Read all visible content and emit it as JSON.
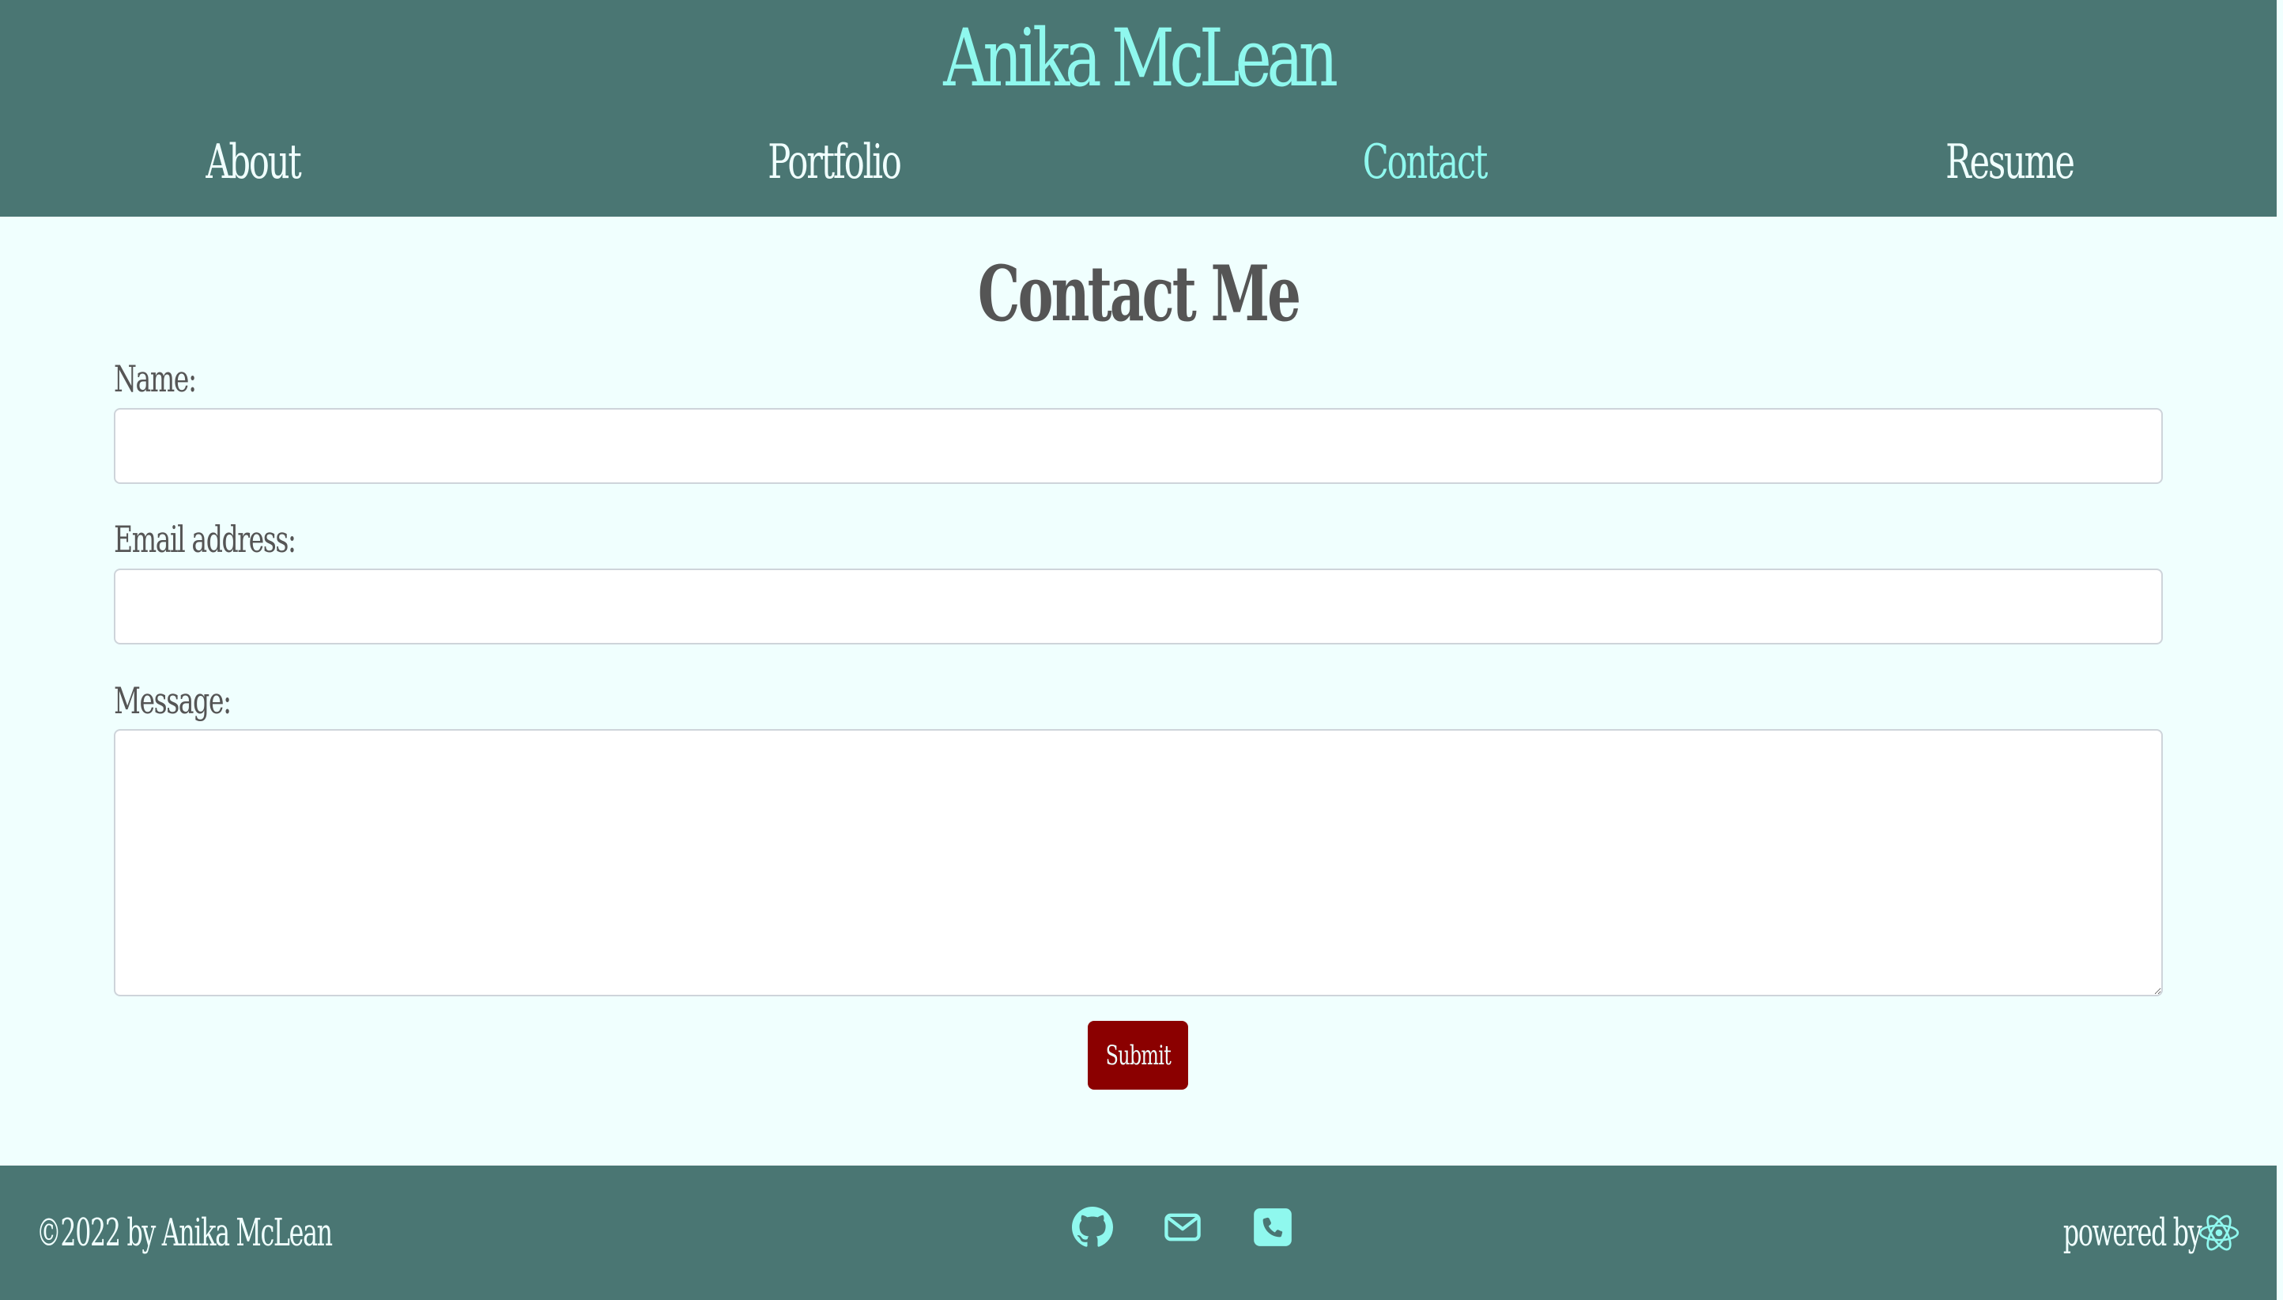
{
  "header": {
    "site_title": "Anika McLean",
    "nav": [
      {
        "label": "About",
        "active": false
      },
      {
        "label": "Portfolio",
        "active": false
      },
      {
        "label": "Contact",
        "active": true
      },
      {
        "label": "Resume",
        "active": false
      }
    ]
  },
  "main": {
    "heading": "Contact Me",
    "form": {
      "name_label": "Name:",
      "name_value": "",
      "email_label": "Email address:",
      "email_value": "",
      "message_label": "Message:",
      "message_value": "",
      "submit_label": "Submit"
    }
  },
  "footer": {
    "copyright": "©2022 by Anika McLean",
    "icons": [
      "github-icon",
      "mail-icon",
      "phone-icon"
    ],
    "powered_by": "powered by",
    "powered_icon": "react-icon"
  },
  "colors": {
    "header_bg": "#4a7673",
    "accent": "#8ff8ee",
    "page_bg": "#f0fffe",
    "text": "#555555",
    "button": "#8b0000"
  }
}
